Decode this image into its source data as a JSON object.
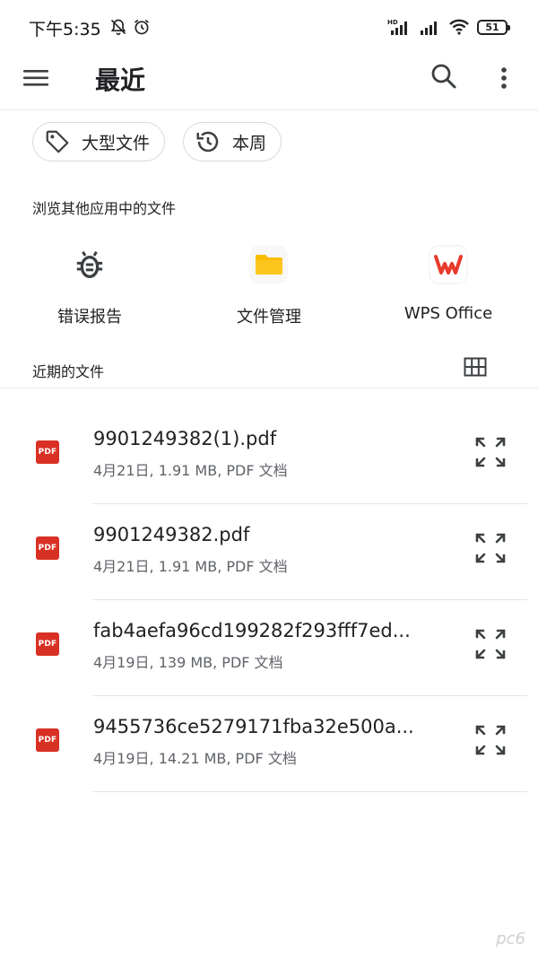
{
  "status_bar": {
    "time": "下午5:35",
    "battery": "51",
    "network_label": "HD"
  },
  "header": {
    "title": "最近"
  },
  "chips": [
    {
      "label": "大型文件",
      "icon": "tag-icon"
    },
    {
      "label": "本周",
      "icon": "history-icon"
    }
  ],
  "browse": {
    "section_title": "浏览其他应用中的文件",
    "apps": [
      {
        "label": "错误报告",
        "icon": "bug-icon"
      },
      {
        "label": "文件管理",
        "icon": "folder-icon"
      },
      {
        "label": "WPS Office",
        "icon": "wps-icon"
      }
    ]
  },
  "recent": {
    "section_title": "近期的文件",
    "files": [
      {
        "name": "9901249382(1).pdf",
        "meta": "4月21日, 1.91 MB, PDF 文档",
        "type_badge": "PDF"
      },
      {
        "name": "9901249382.pdf",
        "meta": "4月21日, 1.91 MB, PDF 文档",
        "type_badge": "PDF"
      },
      {
        "name": "fab4aefa96cd199282f293fff7ed...",
        "meta": "4月19日, 139 MB, PDF 文档",
        "type_badge": "PDF"
      },
      {
        "name": "9455736ce5279171fba32e500a...",
        "meta": "4月19日, 14.21 MB, PDF 文档",
        "type_badge": "PDF"
      }
    ]
  },
  "watermark": "pc6",
  "colors": {
    "pdf_red": "#d93025",
    "folder_yellow": "#fbbc04",
    "wps_red": "#e8392b",
    "text_primary": "#202124",
    "text_secondary": "#5f6368"
  }
}
